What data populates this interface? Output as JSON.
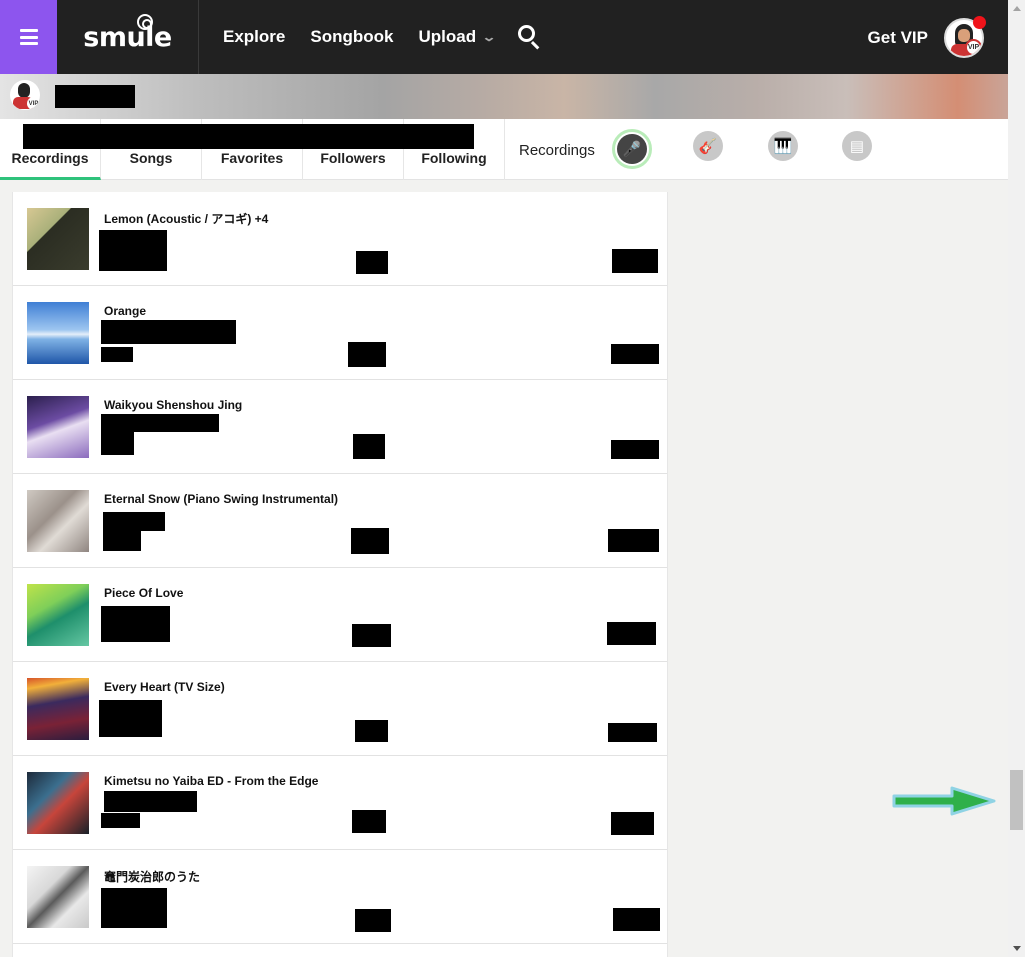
{
  "header": {
    "menu_icon": "hamburger-icon",
    "logo_text": "smule",
    "nav": [
      "Explore",
      "Songbook",
      "Upload"
    ],
    "upload_chevron": "chevron-down-icon",
    "search_icon": "search-icon",
    "get_vip": "Get VIP",
    "avatar_badge": "VIP"
  },
  "profile": {
    "avatar_badge": "VIP"
  },
  "tabs": [
    {
      "label": "Recordings",
      "active": true
    },
    {
      "label": "Songs",
      "active": false
    },
    {
      "label": "Favorites",
      "active": false
    },
    {
      "label": "Followers",
      "active": false
    },
    {
      "label": "Following",
      "active": false
    }
  ],
  "filter": {
    "label": "Recordings",
    "icons": [
      "microphone-icon",
      "guitar-icon",
      "piano-icon",
      "band-icon"
    ],
    "active_icon": "microphone-icon"
  },
  "recordings": [
    {
      "title": "Lemon (Acoustic / アコギ) +4"
    },
    {
      "title": "Orange"
    },
    {
      "title": "Waikyou Shenshou Jing"
    },
    {
      "title": "Eternal Snow (Piano Swing Instrumental)"
    },
    {
      "title": "Piece Of Love"
    },
    {
      "title": "Every Heart (TV Size)"
    },
    {
      "title": "Kimetsu no Yaiba ED - From the Edge"
    },
    {
      "title": "竈門炭治郎のうた"
    }
  ],
  "colors": {
    "menu_accent": "#8d55ee",
    "active_tab_underline": "#2fc27b",
    "annotation_arrow": "#2fb04a"
  }
}
